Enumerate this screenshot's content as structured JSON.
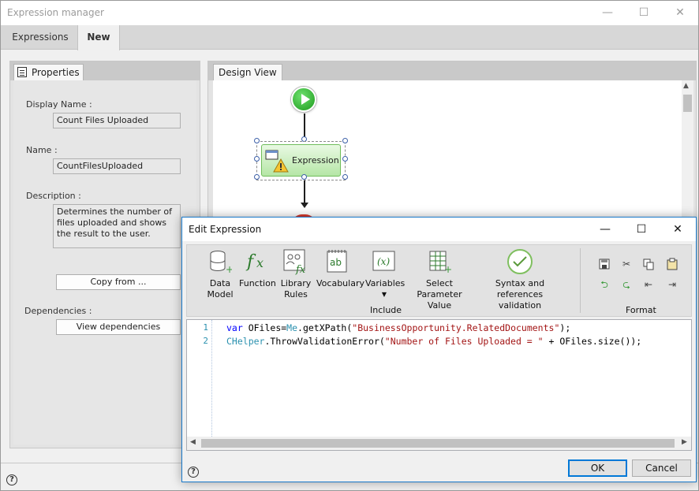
{
  "window": {
    "title": "Expression manager",
    "minimize": "—",
    "maximize": "☐",
    "close": "✕"
  },
  "tabs": [
    {
      "label": "Expressions",
      "active": false
    },
    {
      "label": "New",
      "active": true
    }
  ],
  "properties": {
    "tab_label": "Properties",
    "display_name_label": "Display Name :",
    "display_name_value": "Count Files Uploaded",
    "name_label": "Name :",
    "name_value": "CountFilesUploaded",
    "description_label": "Description :",
    "description_value": "Determines the number of files uploaded and shows the result to the user.",
    "copy_from_label": "Copy from ...",
    "dependencies_label": "Dependencies :",
    "view_dependencies_label": "View dependencies"
  },
  "design_view": {
    "tab_label": "Design View",
    "expression_node_label": "Expression"
  },
  "dialog": {
    "title": "Edit Expression",
    "minimize": "—",
    "maximize": "☐",
    "close": "✕",
    "ribbon": {
      "data_model": "Data Model",
      "function": "Function",
      "library_rules": "Library Rules",
      "vocabulary": "Vocabulary",
      "variables": "Variables",
      "select_parameter_value": "Select Parameter Value",
      "syntax_validation": "Syntax and references validation",
      "include_group": "Include",
      "format_group": "Format"
    },
    "code_lines": [
      {
        "num": "1",
        "parts": [
          {
            "t": "var ",
            "c": "kw"
          },
          {
            "t": "OFiles=",
            "c": "id"
          },
          {
            "t": "Me",
            "c": "obj"
          },
          {
            "t": ".getXPath(",
            "c": "id"
          },
          {
            "t": "\"BusinessOpportunity.RelatedDocuments\"",
            "c": "str"
          },
          {
            "t": ");",
            "c": "id"
          }
        ]
      },
      {
        "num": "2",
        "parts": [
          {
            "t": "CHelper",
            "c": "obj"
          },
          {
            "t": ".ThrowValidationError(",
            "c": "id"
          },
          {
            "t": "\"Number of Files Uploaded = \"",
            "c": "str"
          },
          {
            "t": " + OFiles.size());",
            "c": "id"
          }
        ]
      }
    ],
    "ok_label": "OK",
    "cancel_label": "Cancel"
  },
  "help_icon": "?",
  "colors": {
    "accent": "#0078d7",
    "start_node": "#22a322",
    "end_node": "#d93a2e",
    "expression_node": "#b5e6a6"
  }
}
